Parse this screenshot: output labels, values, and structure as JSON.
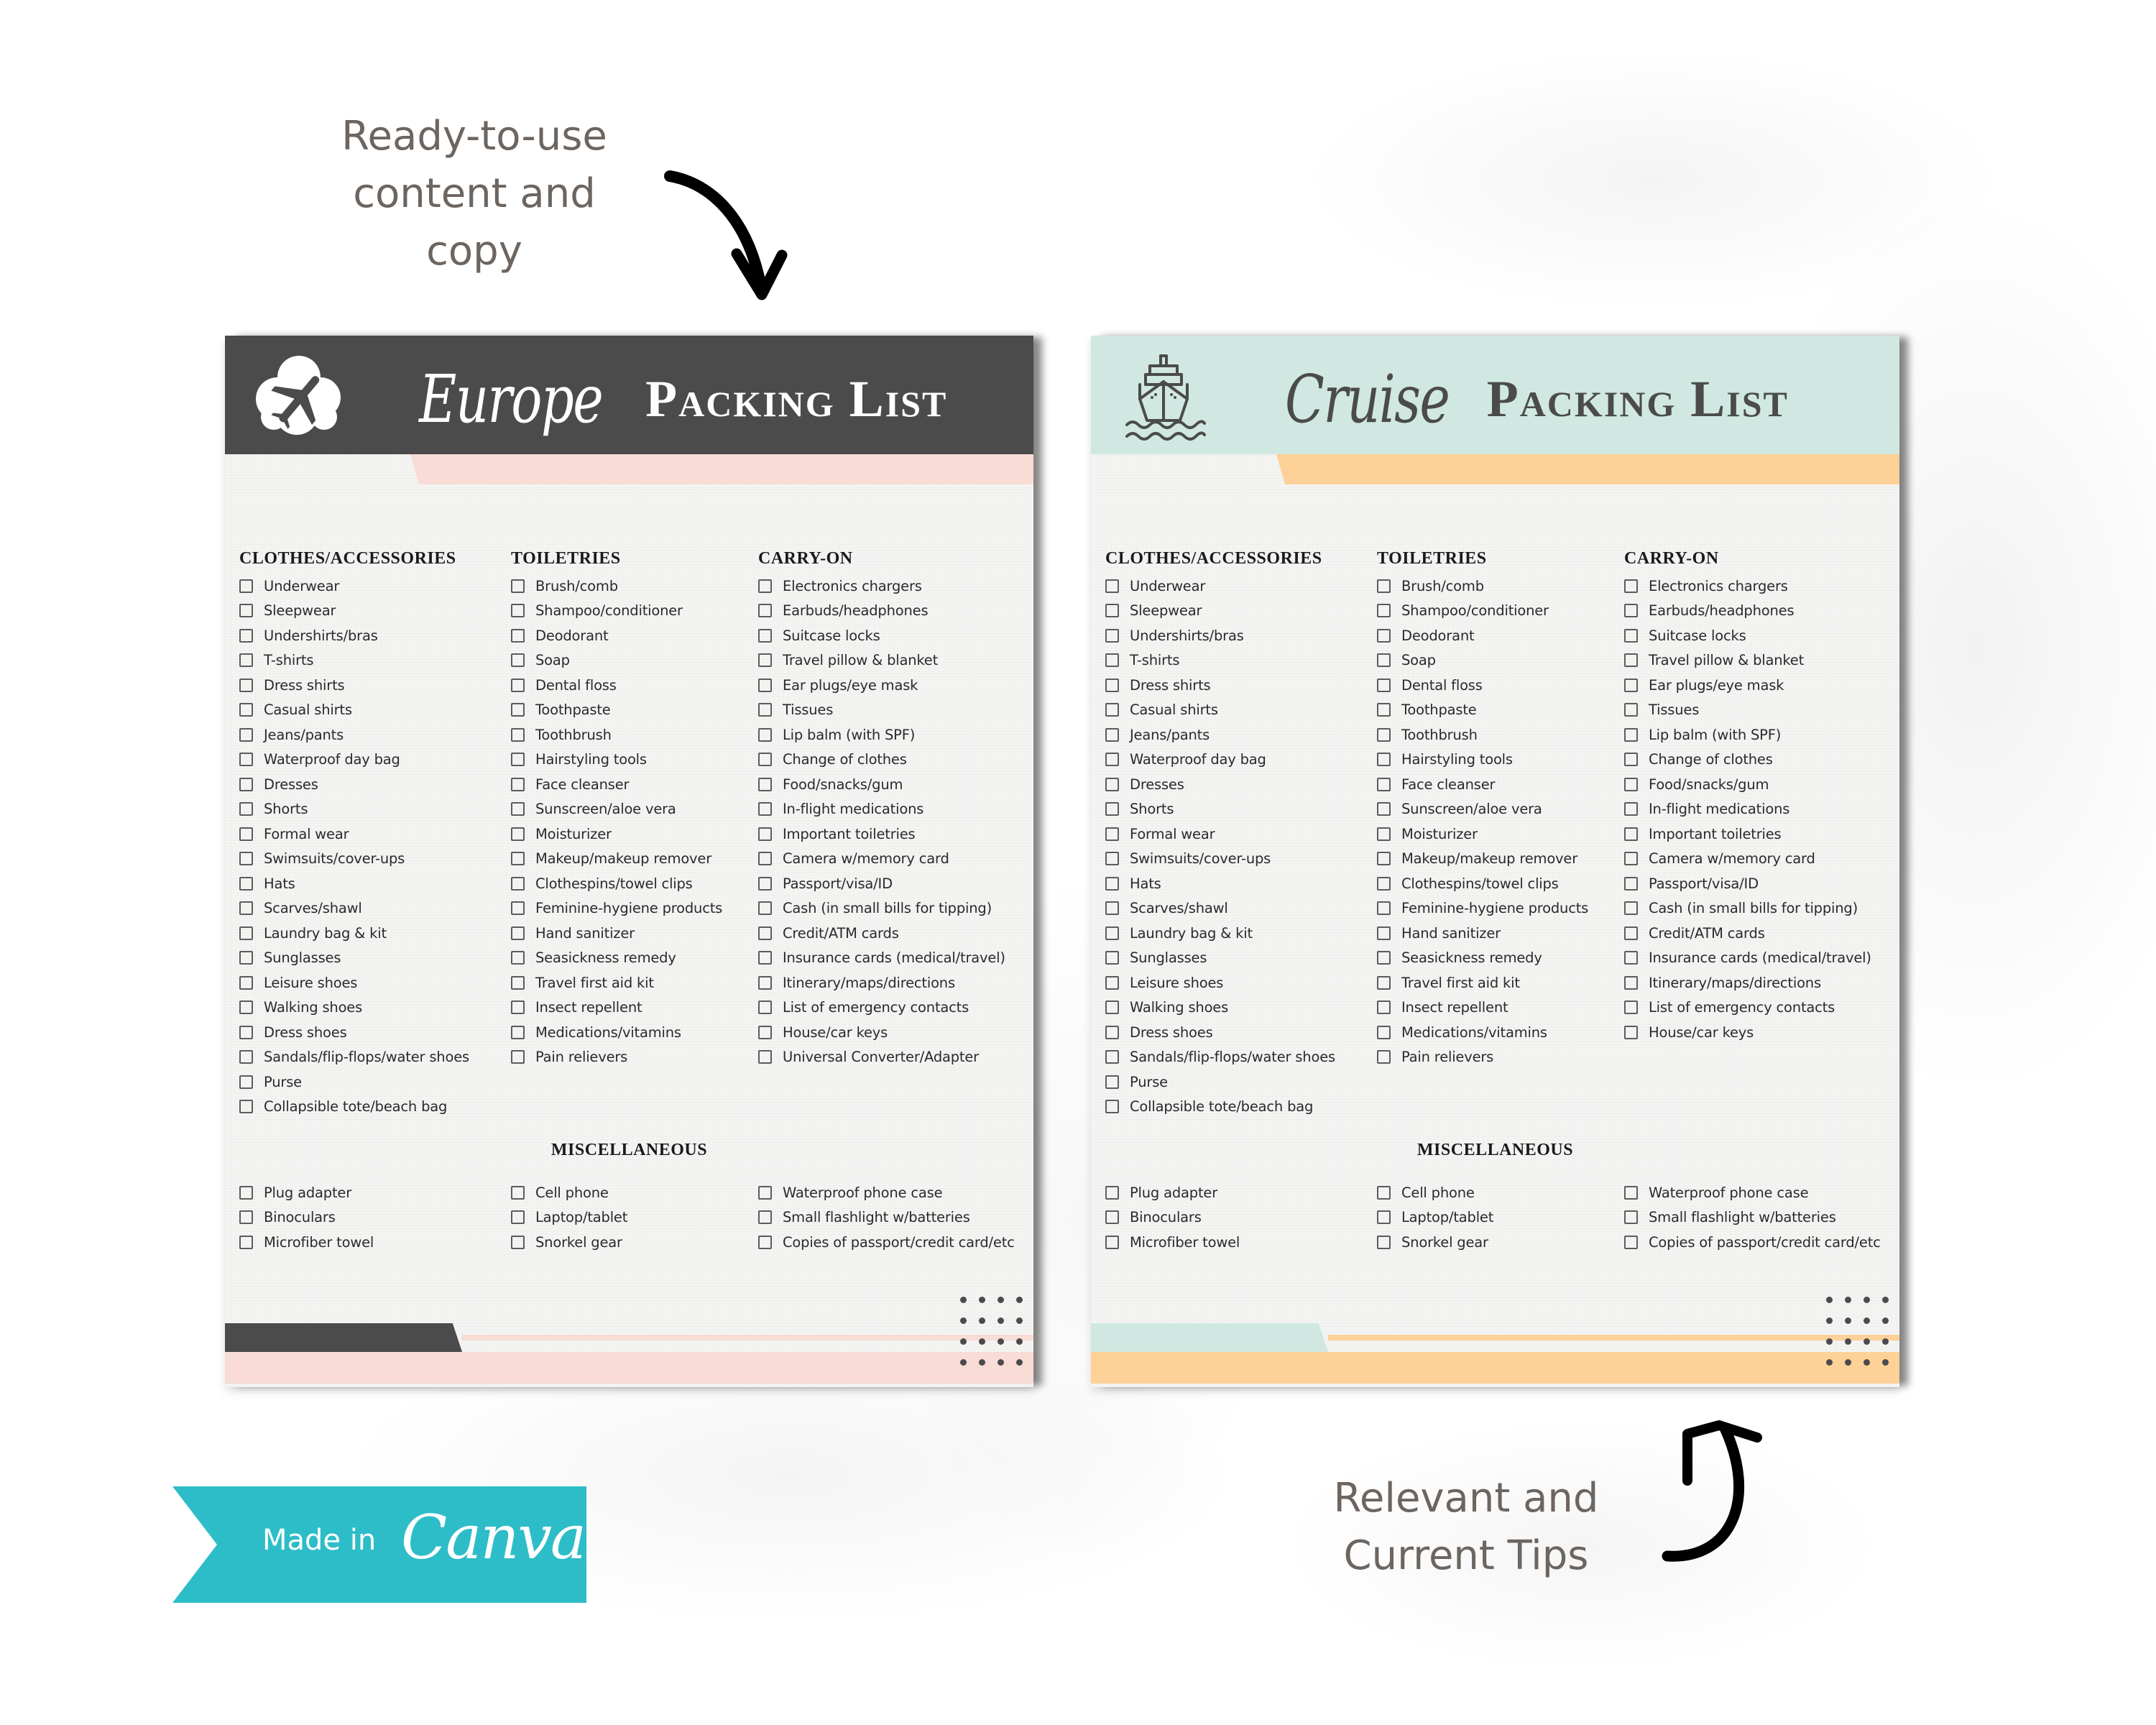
{
  "callouts": {
    "top": [
      "Ready-to-use",
      "content and",
      "copy"
    ],
    "bottom": [
      "Relevant and",
      "Current Tips"
    ]
  },
  "badge": {
    "made_in": "Made in",
    "brand": "Canva",
    "color": "#2dbdc8"
  },
  "europe": {
    "script_word": "Europe",
    "title": "Packing List",
    "icon": "airplane-cloud-icon",
    "colors": {
      "header": "#4b4b4b",
      "accent": "#f8dcd5"
    },
    "columns": [
      {
        "heading": "CLOTHES/ACCESSORIES",
        "items": [
          "Underwear",
          "Sleepwear",
          "Undershirts/bras",
          "T-shirts",
          "Dress shirts",
          "Casual shirts",
          "Jeans/pants",
          "Waterproof day bag",
          "Dresses",
          "Shorts",
          "Formal wear",
          "Swimsuits/cover-ups",
          "Hats",
          "Scarves/shawl",
          "Laundry bag & kit",
          "Sunglasses",
          "Leisure shoes",
          "Walking shoes",
          "Dress shoes",
          "Sandals/flip-flops/water shoes",
          "Purse",
          "Collapsible tote/beach bag"
        ]
      },
      {
        "heading": "TOILETRIES",
        "items": [
          "Brush/comb",
          "Shampoo/conditioner",
          "Deodorant",
          "Soap",
          "Dental floss",
          "Toothpaste",
          "Toothbrush",
          "Hairstyling tools",
          "Face cleanser",
          "Sunscreen/aloe vera",
          "Moisturizer",
          "Makeup/makeup remover",
          "Clothespins/towel clips",
          "Feminine-hygiene products",
          "Hand sanitizer",
          "Seasickness remedy",
          "Travel first aid kit",
          "Insect repellent",
          "Medications/vitamins",
          "Pain relievers"
        ]
      },
      {
        "heading": "CARRY-ON",
        "items": [
          "Electronics chargers",
          "Earbuds/headphones",
          "Suitcase locks",
          "Travel pillow & blanket",
          "Ear plugs/eye mask",
          "Tissues",
          "Lip balm (with SPF)",
          "Change of clothes",
          "Food/snacks/gum",
          "In-flight medications",
          "Important toiletries",
          "Camera w/memory card",
          "Passport/visa/ID",
          "Cash (in small bills for tipping)",
          "Credit/ATM cards",
          "Insurance cards (medical/travel)",
          "Itinerary/maps/directions",
          "List of emergency contacts",
          "House/car keys",
          "Universal Converter/Adapter"
        ]
      }
    ],
    "misc": {
      "heading": "MISCELLANEOUS",
      "columns": [
        [
          "Plug adapter",
          "Binoculars",
          "Microfiber towel"
        ],
        [
          "Cell phone",
          "Laptop/tablet",
          "Snorkel gear"
        ],
        [
          "Waterproof phone case",
          "Small flashlight w/batteries",
          "Copies of passport/credit card/etc"
        ]
      ]
    }
  },
  "cruise": {
    "script_word": "Cruise",
    "title": "Packing List",
    "icon": "cruise-ship-icon",
    "colors": {
      "header": "#d0e8e1",
      "accent": "#fdd197"
    },
    "columns": [
      {
        "heading": "CLOTHES/ACCESSORIES",
        "items": [
          "Underwear",
          "Sleepwear",
          "Undershirts/bras",
          "T-shirts",
          "Dress shirts",
          "Casual shirts",
          "Jeans/pants",
          "Waterproof day bag",
          "Dresses",
          "Shorts",
          "Formal wear",
          "Swimsuits/cover-ups",
          "Hats",
          "Scarves/shawl",
          "Laundry bag & kit",
          "Sunglasses",
          "Leisure shoes",
          "Walking shoes",
          "Dress shoes",
          "Sandals/flip-flops/water shoes",
          "Purse",
          "Collapsible tote/beach bag"
        ]
      },
      {
        "heading": "TOILETRIES",
        "items": [
          "Brush/comb",
          "Shampoo/conditioner",
          "Deodorant",
          "Soap",
          "Dental floss",
          "Toothpaste",
          "Toothbrush",
          "Hairstyling tools",
          "Face cleanser",
          "Sunscreen/aloe vera",
          "Moisturizer",
          "Makeup/makeup remover",
          "Clothespins/towel clips",
          "Feminine-hygiene products",
          "Hand sanitizer",
          "Seasickness remedy",
          "Travel first aid kit",
          "Insect repellent",
          "Medications/vitamins",
          "Pain relievers"
        ]
      },
      {
        "heading": "CARRY-ON",
        "items": [
          "Electronics chargers",
          "Earbuds/headphones",
          "Suitcase locks",
          "Travel pillow & blanket",
          "Ear plugs/eye mask",
          "Tissues",
          "Lip balm (with SPF)",
          "Change of clothes",
          "Food/snacks/gum",
          "In-flight medications",
          "Important toiletries",
          "Camera w/memory card",
          "Passport/visa/ID",
          "Cash (in small bills for tipping)",
          "Credit/ATM cards",
          "Insurance cards (medical/travel)",
          "Itinerary/maps/directions",
          "List of emergency contacts",
          "House/car keys"
        ]
      }
    ],
    "misc": {
      "heading": "MISCELLANEOUS",
      "columns": [
        [
          "Plug adapter",
          "Binoculars",
          "Microfiber towel"
        ],
        [
          "Cell phone",
          "Laptop/tablet",
          "Snorkel gear"
        ],
        [
          "Waterproof phone case",
          "Small flashlight w/batteries",
          "Copies of passport/credit card/etc"
        ]
      ]
    }
  }
}
